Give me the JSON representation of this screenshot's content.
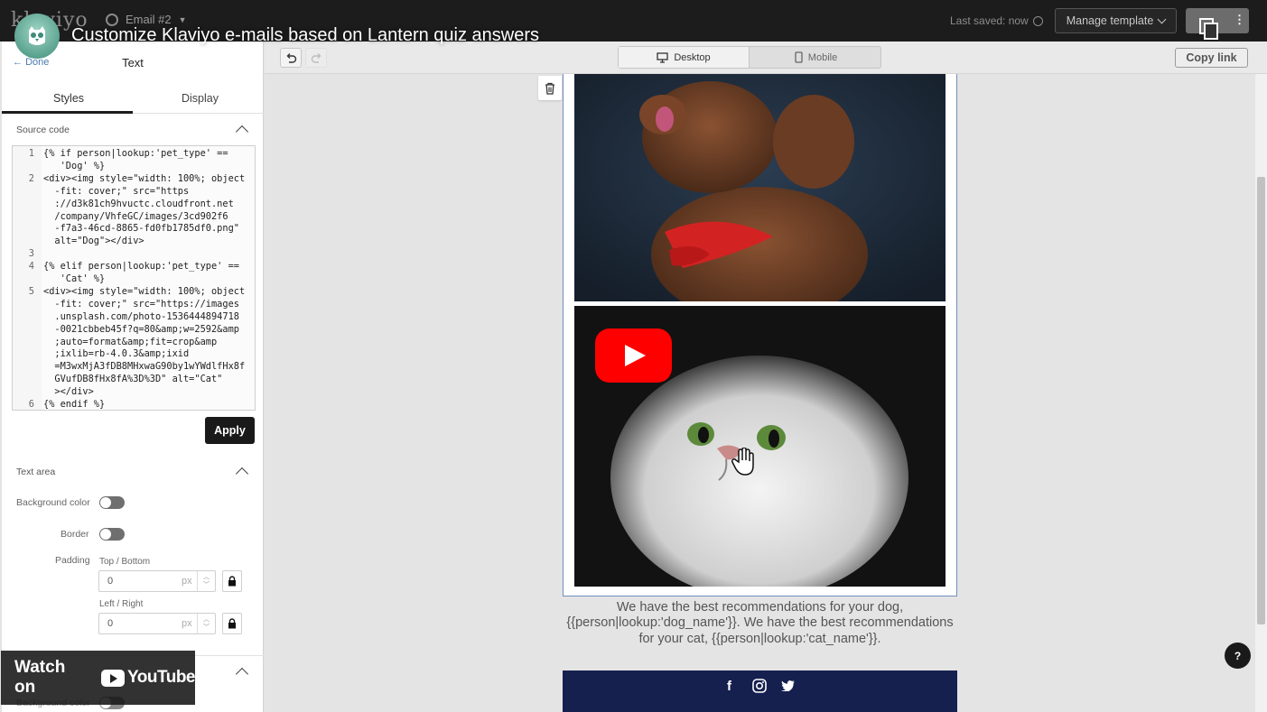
{
  "app": {
    "logo_text": "klaviyo",
    "email_name": "Email #2",
    "last_saved": "Last saved: now",
    "manage_template": "Manage template",
    "copy_link": "Copy link"
  },
  "video": {
    "title": "Customize Klaviyo e-mails based on Lantern quiz answers",
    "watch_on": "Watch on",
    "youtube": "YouTube"
  },
  "panel": {
    "done": "Done",
    "title": "Text",
    "tabs": [
      "Styles",
      "Display"
    ],
    "source_code_label": "Source code",
    "code_lines": [
      {
        "n": "1",
        "text": "{% if person|lookup:'pet_type' =="
      },
      {
        "n": "",
        "text": "   'Dog' %}"
      },
      {
        "n": "2",
        "text": "<div><img style=\"width: 100%; object"
      },
      {
        "n": "",
        "text": "  -fit: cover;\" src=\"https"
      },
      {
        "n": "",
        "text": "  ://d3k81ch9hvuctc.cloudfront.net"
      },
      {
        "n": "",
        "text": "  /company/VhfeGC/images/3cd902f6"
      },
      {
        "n": "",
        "text": "  -f7a3-46cd-8865-fd0fb1785df0.png\""
      },
      {
        "n": "",
        "text": "  alt=\"Dog\"></div>"
      },
      {
        "n": "3",
        "text": ""
      },
      {
        "n": "4",
        "text": "{% elif person|lookup:'pet_type' =="
      },
      {
        "n": "",
        "text": "   'Cat' %}"
      },
      {
        "n": "5",
        "text": "<div><img style=\"width: 100%; object"
      },
      {
        "n": "",
        "text": "  -fit: cover;\" src=\"https://images"
      },
      {
        "n": "",
        "text": "  .unsplash.com/photo-1536444894718"
      },
      {
        "n": "",
        "text": "  -0021cbbeb45f?q=80&amp;w=2592&amp"
      },
      {
        "n": "",
        "text": "  ;auto=format&amp;fit=crop&amp"
      },
      {
        "n": "",
        "text": "  ;ixlib=rb-4.0.3&amp;ixid"
      },
      {
        "n": "",
        "text": "  =M3wxMjA3fDB8MHxwaG90by1wYWdlfHx8f"
      },
      {
        "n": "",
        "text": "  GVufDB8fHx8fA%3D%3D\" alt=\"Cat\""
      },
      {
        "n": "",
        "text": "  ></div>"
      },
      {
        "n": "6",
        "text": "{% endif %}"
      }
    ],
    "apply": "Apply",
    "text_area_label": "Text area",
    "background_color": "Background color",
    "border": "Border",
    "padding": "Padding",
    "top_bottom": "Top / Bottom",
    "left_right": "Left / Right",
    "padding_tb_value": "0",
    "padding_lr_value": "0",
    "unit": "px",
    "next_background_color": "Background color"
  },
  "canvas": {
    "desktop": "Desktop",
    "mobile": "Mobile",
    "email_text": "We have the best recommendations for your dog, {{person|lookup:'dog_name'}}. We have the best recommendations for your cat, {{person|lookup:'cat_name'}}.",
    "help": "?"
  },
  "colors": {
    "topbar": "#1c1c1c",
    "footer": "#16204f",
    "selection_border": "#6f8fbf",
    "yt_red": "#ff0000"
  }
}
